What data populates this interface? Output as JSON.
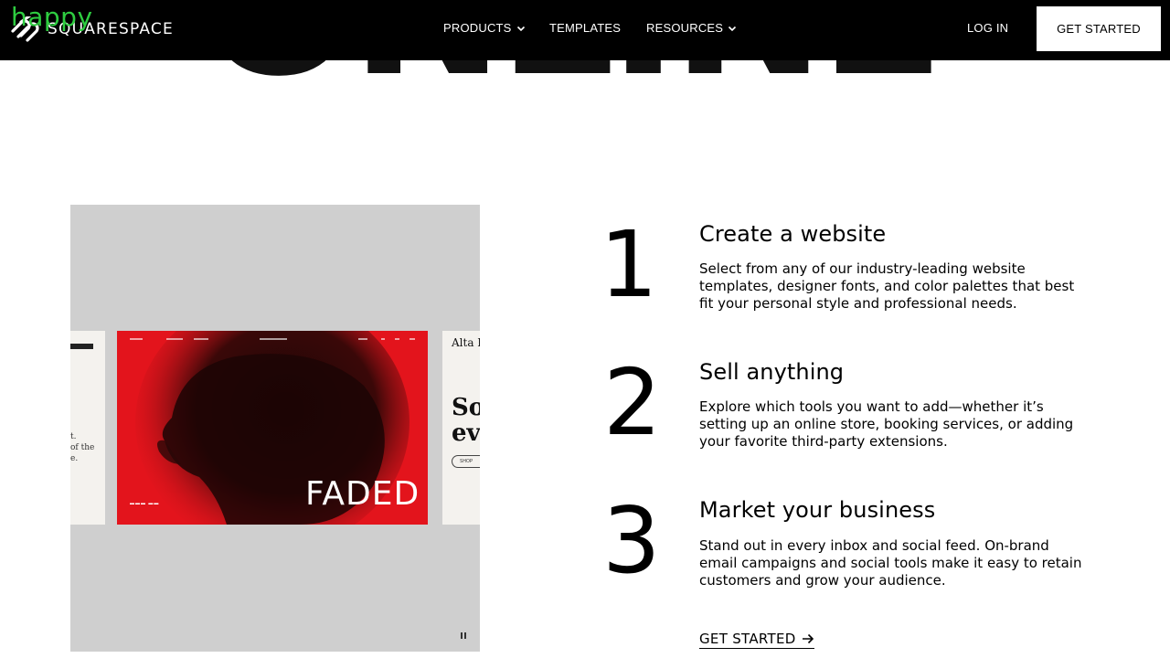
{
  "watermark": "happy",
  "nav": {
    "brand": "SQUARESPACE",
    "links": [
      {
        "label": "PRODUCTS"
      },
      {
        "label": "TEMPLATES"
      },
      {
        "label": "RESOURCES"
      }
    ],
    "login_label": "LOG IN",
    "cta_label": "GET STARTED"
  },
  "hero": {
    "word": "ONLINE"
  },
  "media": {
    "feature_title": "FADED",
    "left_snippet": "t.\nof the\ne.",
    "right_title": "Alta Lo",
    "right_heading": "Soa\neve",
    "right_button": "SHOP"
  },
  "steps": [
    {
      "number": "1",
      "title": "Create a website",
      "description": "Select from any of our industry-leading website templates, designer fonts, and color palettes that best fit your personal style and professional needs."
    },
    {
      "number": "2",
      "title": "Sell anything",
      "description": "Explore which tools you want to add—whether it’s setting up an online store, booking services, or adding your favorite third-party extensions."
    },
    {
      "number": "3",
      "title": "Market your business",
      "description": "Stand out in every inbox and social feed. On-brand email campaigns and social tools make it easy to retain customers and grow your audience."
    }
  ],
  "cta_link": {
    "label": "GET STARTED",
    "icon": "arrow-right-icon"
  }
}
